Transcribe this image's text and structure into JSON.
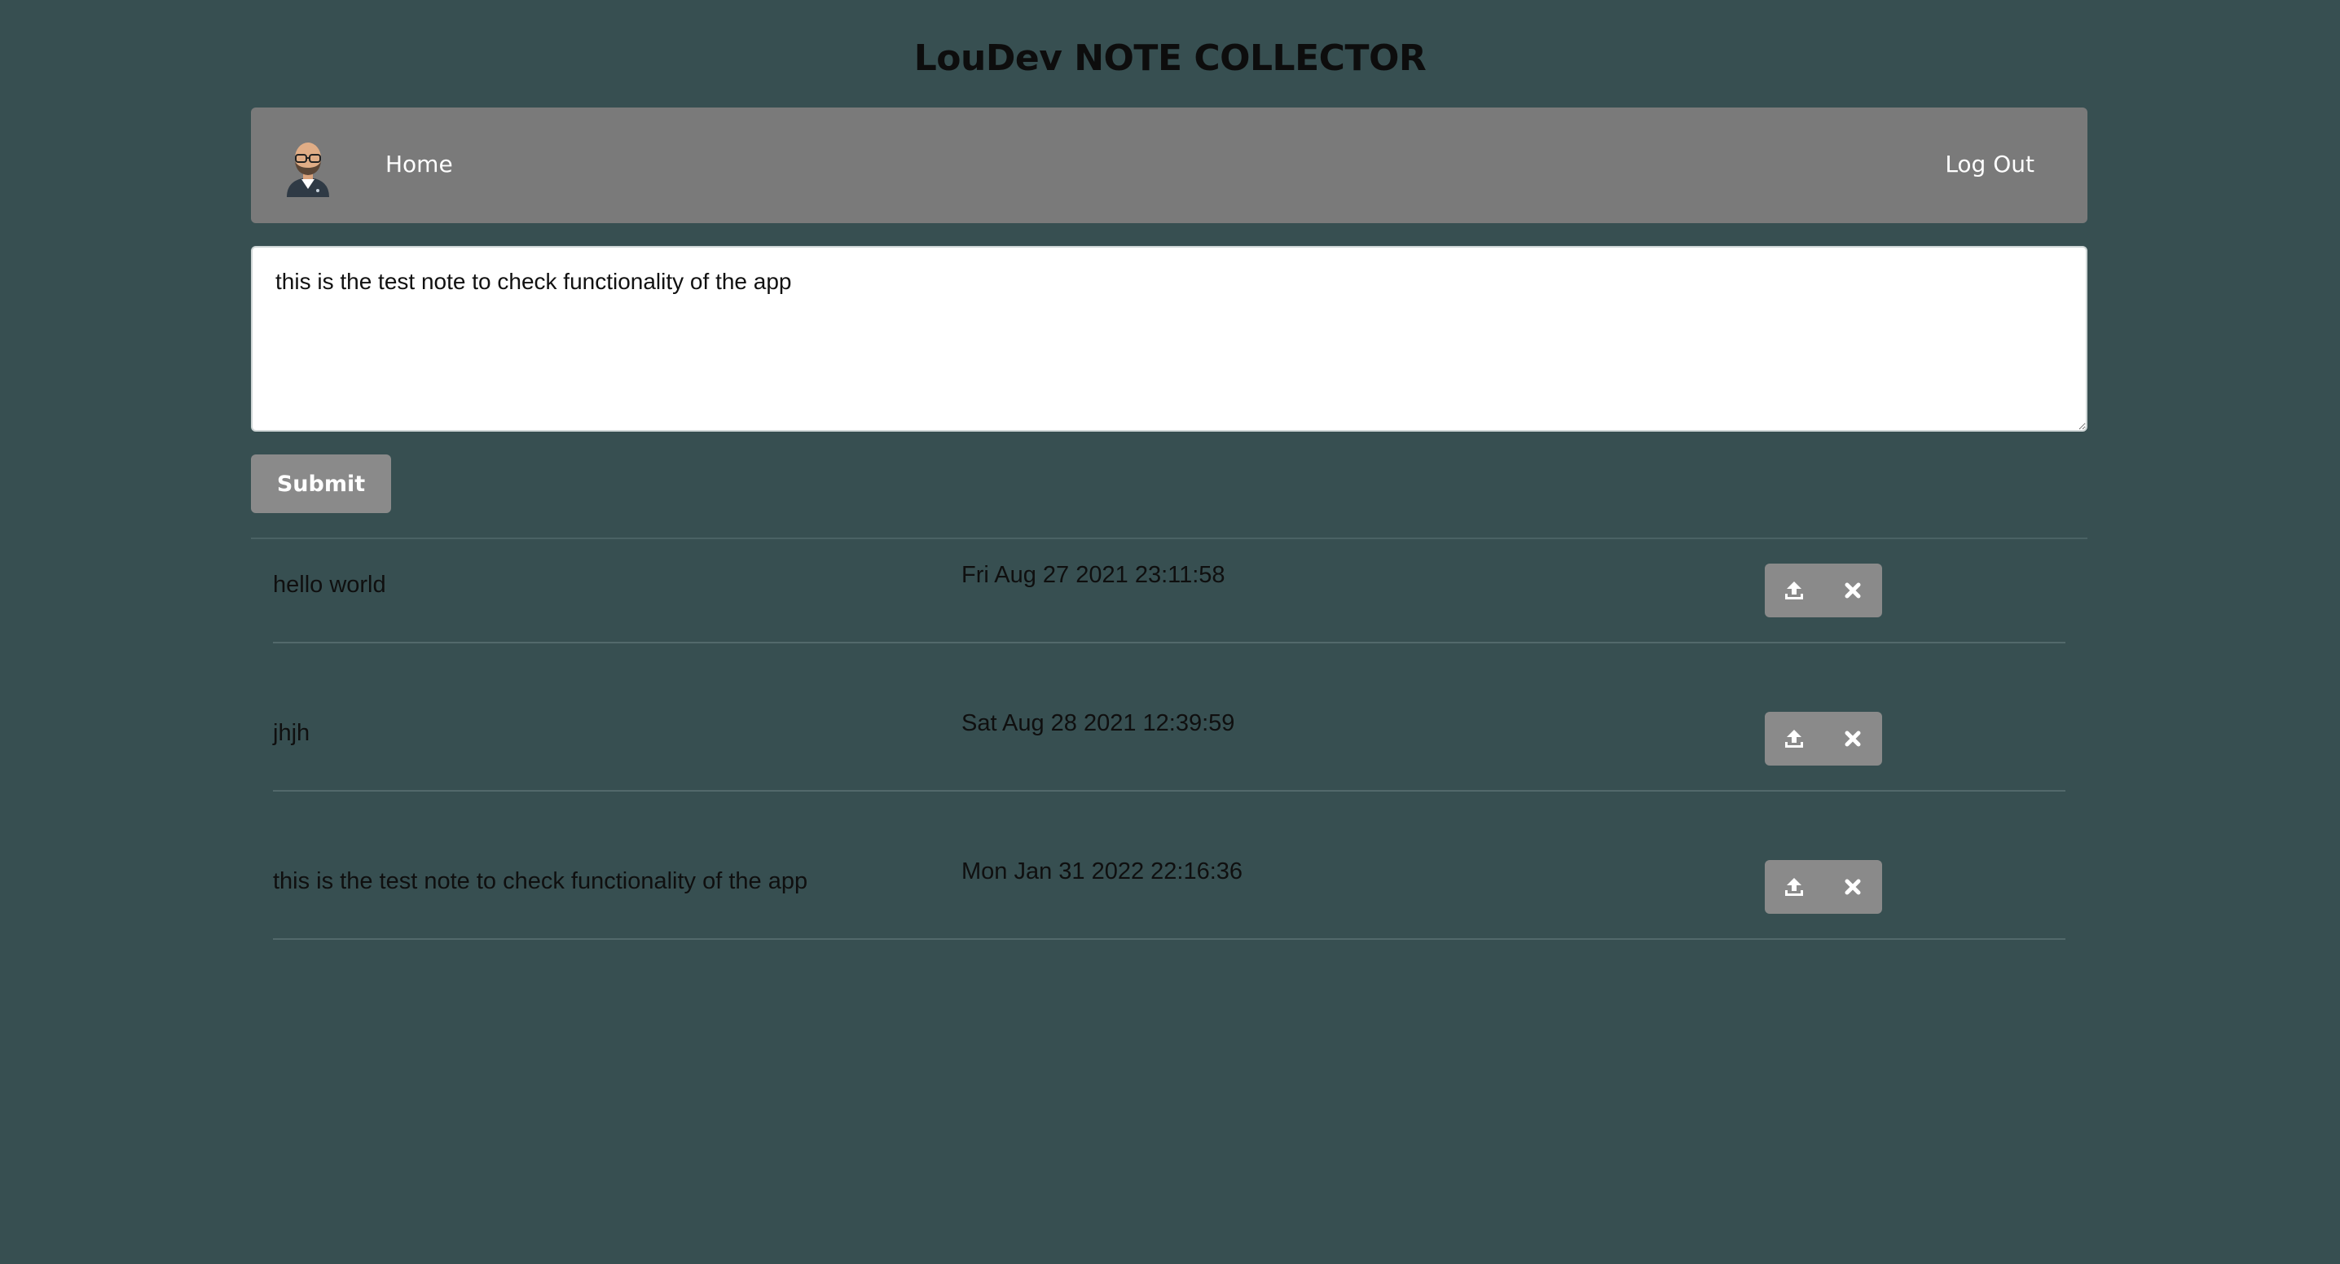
{
  "header": {
    "title": "LouDev NOTE COLLECTOR"
  },
  "navbar": {
    "avatar_icon": "avatar-icon",
    "home_label": "Home",
    "logout_label": "Log Out"
  },
  "editor": {
    "value": "this is the test note to check functionality of the app",
    "placeholder": ""
  },
  "submit": {
    "label": "Submit"
  },
  "notes": [
    {
      "text": "hello world",
      "date": "Fri Aug 27 2021 23:11:58",
      "update_icon": "upload-icon",
      "delete_icon": "close-icon"
    },
    {
      "text": "jhjh",
      "date": "Sat Aug 28 2021 12:39:59",
      "update_icon": "upload-icon",
      "delete_icon": "close-icon"
    },
    {
      "text": "this is the test note to check functionality of the app",
      "date": "Mon Jan 31 2022 22:16:36",
      "update_icon": "upload-icon",
      "delete_icon": "close-icon"
    }
  ],
  "colors": {
    "background": "#374f51",
    "navbar": "#7a7a7a",
    "button": "#8a8a8a"
  }
}
